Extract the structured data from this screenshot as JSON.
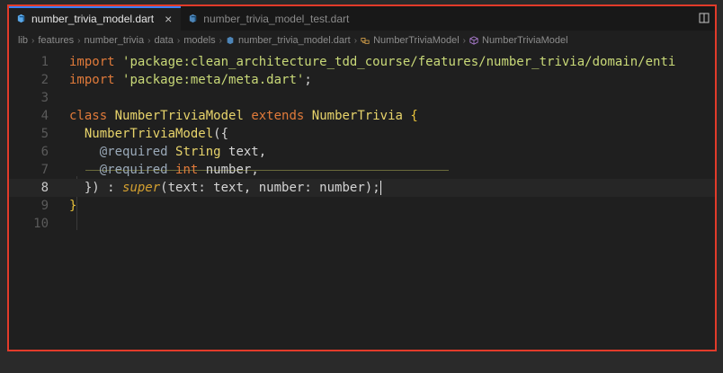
{
  "tabs": [
    {
      "label": "number_trivia_model.dart",
      "active": true,
      "icon": "dart-icon"
    },
    {
      "label": "number_trivia_model_test.dart",
      "active": false,
      "icon": "dart-icon"
    }
  ],
  "tab_close_glyph": "×",
  "breadcrumb": {
    "segments": [
      "lib",
      "features",
      "number_trivia",
      "data",
      "models",
      "number_trivia_model.dart",
      "NumberTriviaModel",
      "NumberTriviaModel"
    ]
  },
  "editor": {
    "line_numbers": [
      "1",
      "2",
      "3",
      "4",
      "5",
      "6",
      "7",
      "8",
      "9",
      "10"
    ],
    "current_line": "8",
    "lines": [
      {
        "tokens": [
          [
            "kw",
            "import"
          ],
          [
            "plain",
            " "
          ],
          [
            "str",
            "'package:clean_architecture_tdd_course/features/number_trivia/domain/enti"
          ]
        ]
      },
      {
        "tokens": [
          [
            "kw",
            "import"
          ],
          [
            "plain",
            " "
          ],
          [
            "str",
            "'package:meta/meta.dart'"
          ],
          [
            "plain",
            ";"
          ]
        ]
      },
      {
        "tokens": []
      },
      {
        "tokens": [
          [
            "kw",
            "class"
          ],
          [
            "plain",
            " "
          ],
          [
            "cls",
            "NumberTriviaModel"
          ],
          [
            "plain",
            " "
          ],
          [
            "kw",
            "extends"
          ],
          [
            "plain",
            " "
          ],
          [
            "cls",
            "NumberTrivia"
          ],
          [
            "plain",
            " "
          ],
          [
            "brace",
            "{"
          ]
        ]
      },
      {
        "tokens": [
          [
            "plain",
            "  "
          ],
          [
            "cls",
            "NumberTriviaModel"
          ],
          [
            "paren",
            "({"
          ]
        ]
      },
      {
        "tokens": [
          [
            "plain",
            "    "
          ],
          [
            "anno",
            "@required"
          ],
          [
            "plain",
            " "
          ],
          [
            "type",
            "String"
          ],
          [
            "plain",
            " text,"
          ]
        ]
      },
      {
        "tokens": [
          [
            "plain",
            "    "
          ],
          [
            "anno",
            "@required"
          ],
          [
            "plain",
            " "
          ],
          [
            "kw",
            "int"
          ],
          [
            "plain",
            " number,"
          ]
        ]
      },
      {
        "tokens": [
          [
            "plain",
            "  "
          ],
          [
            "paren",
            "})"
          ],
          [
            "plain",
            " : "
          ],
          [
            "sup",
            "super"
          ],
          [
            "paren",
            "("
          ],
          [
            "plain",
            "text: text, number: number"
          ],
          [
            "paren",
            ")"
          ],
          [
            "plain",
            ";"
          ]
        ]
      },
      {
        "tokens": [
          [
            "brace",
            "}"
          ]
        ]
      },
      {
        "tokens": []
      }
    ]
  },
  "colors": {
    "frame_border": "#e23b2a",
    "active_tab_accent": "#3b82f6",
    "keyword": "#e07a3a",
    "string": "#c9d978",
    "class": "#e8d46b"
  }
}
